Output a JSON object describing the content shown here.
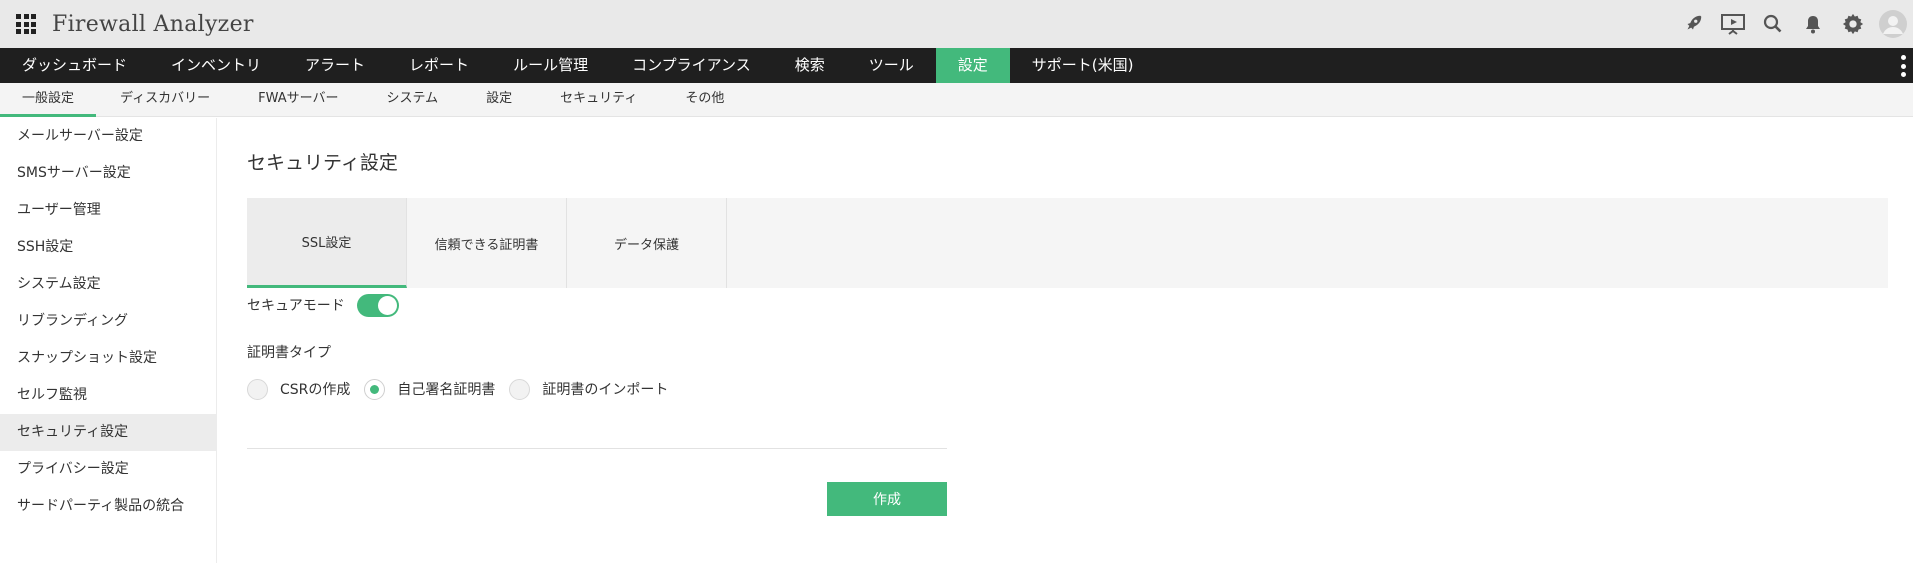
{
  "app": {
    "title": "Firewall Analyzer"
  },
  "header_icons": [
    "rocket-icon",
    "presentation-icon",
    "search-icon",
    "bell-icon",
    "gear-icon",
    "user-avatar-icon"
  ],
  "main_nav": {
    "items": [
      {
        "label": "ダッシュボード"
      },
      {
        "label": "インベントリ"
      },
      {
        "label": "アラート"
      },
      {
        "label": "レポート"
      },
      {
        "label": "ルール管理"
      },
      {
        "label": "コンプライアンス"
      },
      {
        "label": "検索"
      },
      {
        "label": "ツール"
      },
      {
        "label": "設定"
      },
      {
        "label": "サポート(米国)"
      }
    ],
    "active_index": 8
  },
  "sub_nav": {
    "items": [
      {
        "label": "一般設定"
      },
      {
        "label": "ディスカバリー"
      },
      {
        "label": "FWAサーバー"
      },
      {
        "label": "システム"
      },
      {
        "label": "設定"
      },
      {
        "label": "セキュリティ"
      },
      {
        "label": "その他"
      }
    ],
    "active_index": 0
  },
  "sidebar": {
    "items": [
      {
        "label": "メールサーバー設定"
      },
      {
        "label": "SMSサーバー設定"
      },
      {
        "label": "ユーザー管理"
      },
      {
        "label": "SSH設定"
      },
      {
        "label": "システム設定"
      },
      {
        "label": "リブランディング"
      },
      {
        "label": "スナップショット設定"
      },
      {
        "label": "セルフ監視"
      },
      {
        "label": "セキュリティ設定"
      },
      {
        "label": "プライバシー設定"
      },
      {
        "label": "サードパーティ製品の統合"
      }
    ],
    "active_index": 8
  },
  "main": {
    "title": "セキュリティ設定",
    "tabs": [
      {
        "label": "SSL設定"
      },
      {
        "label": "信頼できる証明書"
      },
      {
        "label": "データ保護"
      }
    ],
    "active_tab": 0,
    "secure_mode": {
      "label": "セキュアモード",
      "enabled": true
    },
    "cert_type": {
      "label": "証明書タイプ",
      "options": [
        {
          "label": "CSRの作成",
          "checked": false
        },
        {
          "label": "自己署名証明書",
          "checked": true
        },
        {
          "label": "証明書のインポート",
          "checked": false
        }
      ]
    },
    "create_button": "作成"
  },
  "colors": {
    "accent": "#43b97c",
    "nav_bg": "#1f1f1f",
    "header_bg": "#e9e9e9"
  }
}
